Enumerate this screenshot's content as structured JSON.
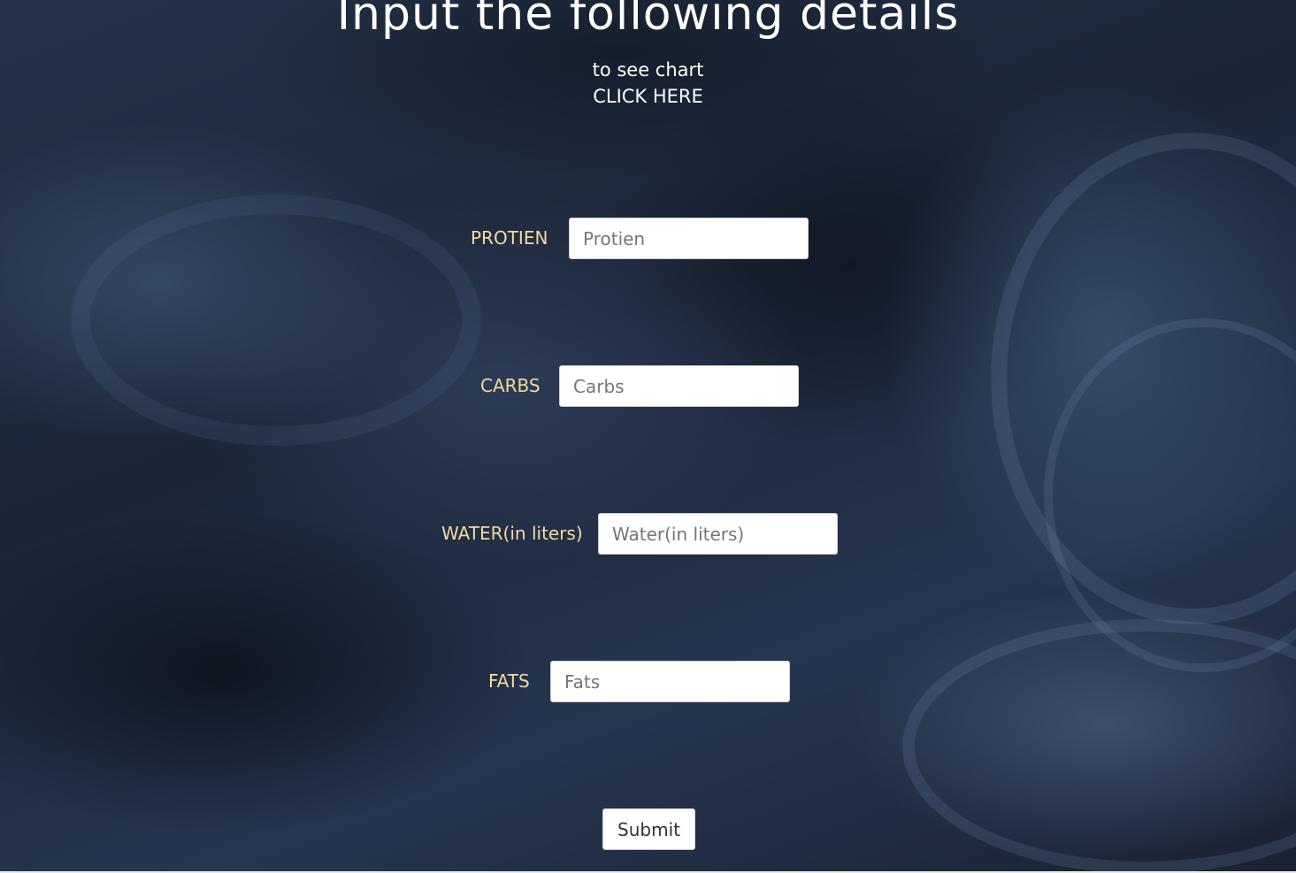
{
  "header": {
    "title": "Input the following details",
    "subtitle": "to see chart",
    "chart_link": "CLICK HERE"
  },
  "form": {
    "fields": [
      {
        "label": "PROTIEN",
        "placeholder": "Protien",
        "value": ""
      },
      {
        "label": "CARBS",
        "placeholder": "Carbs",
        "value": ""
      },
      {
        "label": "WATER(in liters)",
        "placeholder": "Water(in liters)",
        "value": ""
      },
      {
        "label": "FATS",
        "placeholder": "Fats",
        "value": ""
      }
    ],
    "submit_label": "Submit"
  },
  "colors": {
    "label": "#f4d9a4",
    "title": "#ffffff",
    "background": "#1c2738"
  }
}
